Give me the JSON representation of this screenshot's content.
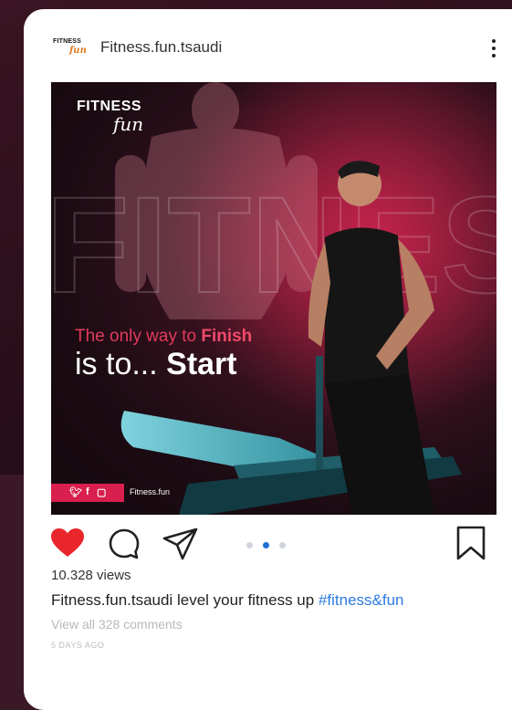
{
  "post": {
    "logo_line1": "FITNESS",
    "logo_line2": "fun",
    "username": "Fitness.fun.tsaudi",
    "image": {
      "logo_top": "FITNESS",
      "logo_bottom": "fun",
      "big_word": "FITNESS",
      "tagline_part1": "The only way to ",
      "tagline_part1_highlight": "Finish",
      "tagline_part2": "is to... ",
      "tagline_part2_highlight": "Start",
      "social_icons": [
        "twitter-icon",
        "facebook-icon",
        "instagram-icon"
      ],
      "handle": "Fitness.fun"
    },
    "carousel": {
      "count": 3,
      "active_index": 1
    },
    "views": "10.328 views",
    "caption_user": "Fitness.fun.tsaudi",
    "caption_text": " level your fitness up ",
    "caption_hashtag": "#fitness&fun",
    "comments_link": "View all 328 comments",
    "timestamp": "5 DAYS AGO"
  },
  "colors": {
    "like_red": "#e8262b",
    "hashtag_blue": "#2d7be0",
    "accent_pink": "#d81f4d",
    "dot_active": "#1f6fd6",
    "dot_inactive": "#cfd4dc"
  }
}
